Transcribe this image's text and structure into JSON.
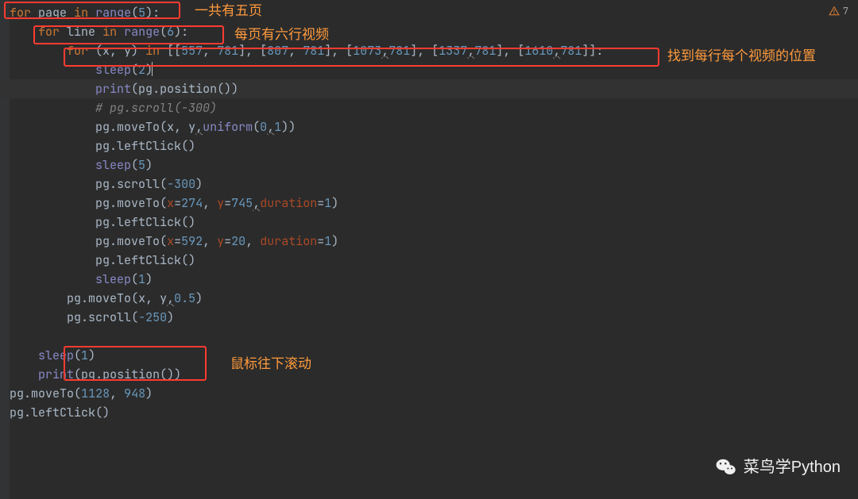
{
  "warning_count": "7",
  "annotations": {
    "a1": "一共有五页",
    "a2": "每页有六行视频",
    "a3": "找到每行每个视频的位置",
    "a4": "鼠标往下滚动"
  },
  "code": {
    "indent0": "",
    "indent1": "    ",
    "indent2": "        ",
    "indent3": "            ",
    "kw_for": "for",
    "kw_in": "in",
    "id_page": "page",
    "id_line": "line",
    "id_xy": "(x, y)",
    "fn_range": "range",
    "num5": "5",
    "num6": "6",
    "coords_list": "[[557, 781], [807, 781], [1073,781], [1337,781], [1610,781]]",
    "numlist": {
      "n557": "557",
      "n781a": "781",
      "n807": "807",
      "n781b": "781",
      "n1073": "1073",
      "n781c": "781",
      "n1337": "1337",
      "n781d": "781",
      "n1610": "1610",
      "n781e": "781"
    },
    "fn_sleep": "sleep",
    "num2": "2",
    "fn_print": "print",
    "pg": "pg",
    "m_position": "position",
    "comment_scroll": "# pg.scroll(-300)",
    "m_moveTo": "moveTo",
    "id_x": "x",
    "id_y": "y",
    "fn_uniform": "uniform",
    "num0": "0",
    "num1": "1",
    "m_leftClick": "leftClick",
    "num5b": "5",
    "m_scroll": "scroll",
    "neg300": "-300",
    "kw_x": "x",
    "kw_y": "y",
    "num274": "274",
    "num745": "745",
    "kw_duration": "duration",
    "num1b": "1",
    "num592": "592",
    "num20": "20",
    "num1c": "1",
    "num05": "0.5",
    "neg250": "-250",
    "num1d": "1",
    "num1128": "1128",
    "num948": "948"
  },
  "watermark": "菜鸟学Python"
}
